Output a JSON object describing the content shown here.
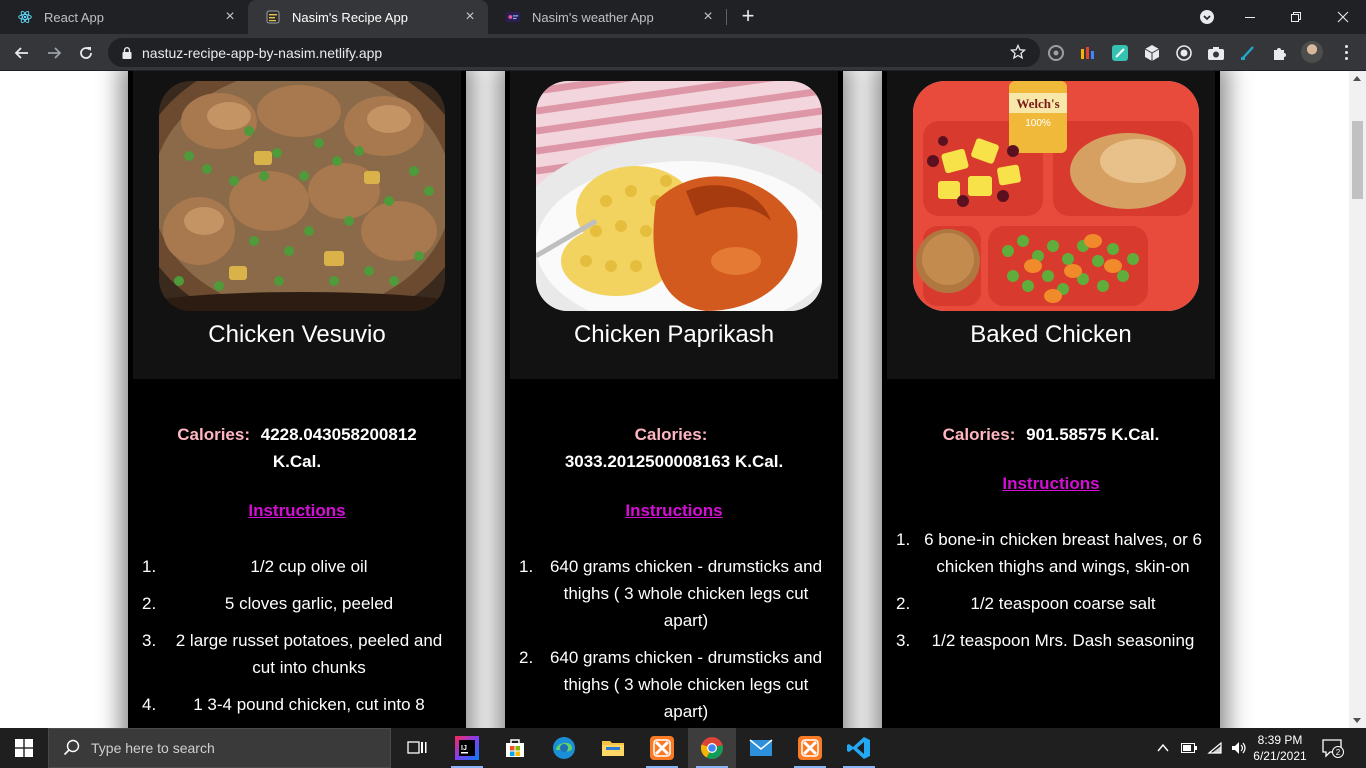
{
  "browser": {
    "tabs": [
      {
        "title": "React App",
        "active": false
      },
      {
        "title": "Nasim's Recipe App",
        "active": true
      },
      {
        "title": "Nasim's weather App",
        "active": false
      }
    ],
    "url": "nastuz-recipe-app-by-nasim.netlify.app"
  },
  "recipes": [
    {
      "name": "Chicken Vesuvio",
      "calories_label": "Calories:",
      "calories_value": "4228.043058200812 K.Cal.",
      "instructions_label": "Instructions",
      "ingredients": [
        {
          "n": "1.",
          "text": "1/2 cup olive oil"
        },
        {
          "n": "2.",
          "text": "5 cloves garlic, peeled"
        },
        {
          "n": "3.",
          "text": "2 large russet potatoes, peeled and cut into chunks"
        },
        {
          "n": "4.",
          "text": "1 3-4 pound chicken, cut into 8"
        }
      ]
    },
    {
      "name": "Chicken Paprikash",
      "calories_label": "Calories:",
      "calories_value": "3033.2012500008163 K.Cal.",
      "instructions_label": "Instructions",
      "ingredients": [
        {
          "n": "1.",
          "text": "640 grams chicken - drumsticks and thighs ( 3 whole chicken legs cut apart)"
        },
        {
          "n": "2.",
          "text": "640 grams chicken - drumsticks and thighs ( 3 whole chicken legs cut apart)"
        }
      ]
    },
    {
      "name": "Baked Chicken",
      "calories_label": "Calories:",
      "calories_value": "901.58575 K.Cal.",
      "instructions_label": "Instructions",
      "ingredients": [
        {
          "n": "1.",
          "text": "6 bone-in chicken breast halves, or 6 chicken thighs and wings, skin-on"
        },
        {
          "n": "2.",
          "text": "1/2 teaspoon coarse salt"
        },
        {
          "n": "3.",
          "text": "1/2 teaspoon Mrs. Dash seasoning"
        }
      ]
    }
  ],
  "photo_text": {
    "can_brand": "Welch's",
    "can_sub": "100%"
  },
  "taskbar": {
    "search_placeholder": "Type here to search",
    "time": "8:39 PM",
    "date": "6/21/2021",
    "notification_count": "2"
  },
  "icons": {
    "tab1": "react-icon",
    "tab2": "recipe-favicon",
    "tab3": "weather-favicon",
    "back": "arrow-left-icon",
    "forward": "arrow-right-icon",
    "reload": "reload-icon",
    "lock": "lock-icon",
    "bookmark": "star-icon"
  }
}
